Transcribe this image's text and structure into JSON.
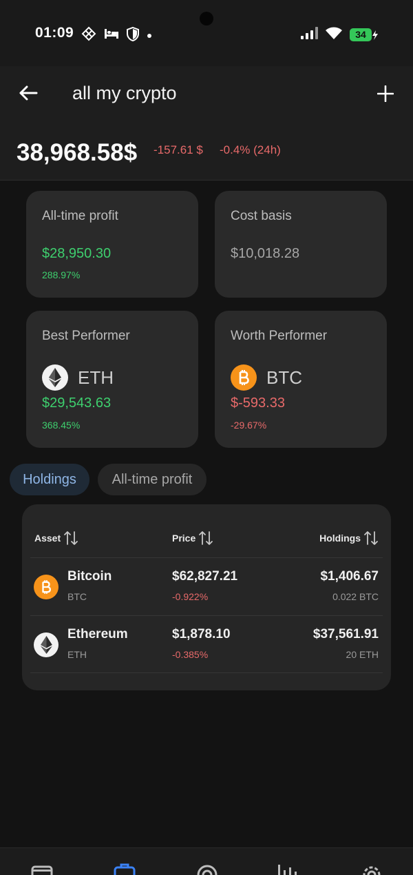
{
  "status_bar": {
    "time": "01:09",
    "battery": "34",
    "left_icons": [
      "grid-diamond-icon",
      "bed-icon",
      "shield-icon",
      "dot-icon"
    ],
    "right_icons": [
      "signal-icon",
      "wifi-icon",
      "battery-icon"
    ]
  },
  "header": {
    "title": "all my crypto",
    "total_value": "38,968.58$",
    "change_abs": "-157.61 $",
    "change_pct": "-0.4% (24h)"
  },
  "cards": {
    "all_time_profit": {
      "label": "All-time profit",
      "value": "$28,950.30",
      "pct": "288.97%"
    },
    "cost_basis": {
      "label": "Cost basis",
      "value": "$10,018.28"
    },
    "best_performer": {
      "label": "Best Performer",
      "symbol": "ETH",
      "value": "$29,543.63",
      "pct": "368.45%"
    },
    "worst_performer": {
      "label": "Worth Performer",
      "symbol": "BTC",
      "value": "$-593.33",
      "pct": "-29.67%"
    }
  },
  "tabs": [
    {
      "label": "Holdings",
      "active": true
    },
    {
      "label": "All-time profit",
      "active": false
    }
  ],
  "table": {
    "headers": {
      "asset": "Asset",
      "price": "Price",
      "holdings": "Holdings"
    },
    "rows": [
      {
        "name": "Bitcoin",
        "symbol": "BTC",
        "price": "$62,827.21",
        "change": "-0.922%",
        "holdings": "$1,406.67",
        "quantity": "0.022 BTC"
      },
      {
        "name": "Ethereum",
        "symbol": "ETH",
        "price": "$1,878.10",
        "change": "-0.385%",
        "holdings": "$37,561.91",
        "quantity": "20 ETH"
      }
    ]
  },
  "bottom_nav": [
    "card-icon",
    "briefcase-icon",
    "target-icon",
    "bar-chart-icon",
    "gear-icon"
  ],
  "colors": {
    "positive": "#3ecf6e",
    "negative": "#e86a6a",
    "accent": "#8fb6e6",
    "nav_active": "#3b82f6",
    "btc": "#f7931a",
    "battery": "#34c759"
  }
}
